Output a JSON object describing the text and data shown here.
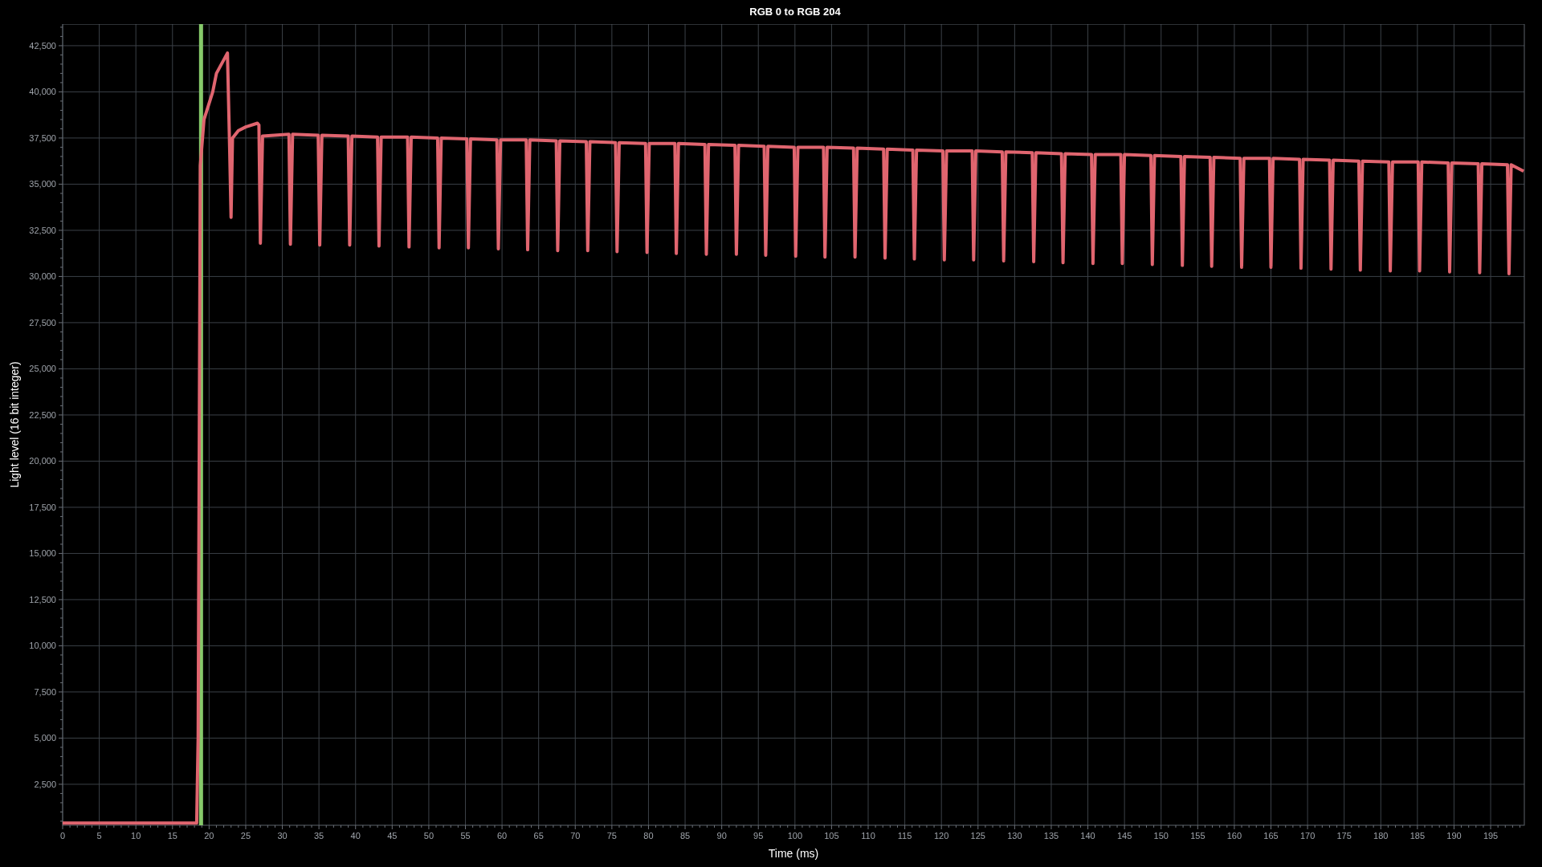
{
  "chart_data": {
    "type": "line",
    "title": "RGB 0 to RGB 204",
    "xlabel": "Time (ms)",
    "ylabel": "Light level (16 bit integer)",
    "x": [
      0,
      18.3,
      18.5,
      18.8,
      19.3,
      20.5,
      21,
      22.5,
      22.8,
      23.0,
      23.2,
      24,
      25,
      26.6,
      26.8,
      27.0,
      27.3,
      30.9,
      31.1,
      31.4,
      34.9,
      35.1,
      35.4,
      39.0,
      39.2,
      39.5,
      43.0,
      43.2,
      43.5,
      47.1,
      47.3,
      47.6,
      51.2,
      51.4,
      51.7,
      55.2,
      55.4,
      55.7,
      59.3,
      59.5,
      59.8,
      63.3,
      63.5,
      63.8,
      67.4,
      67.6,
      67.9,
      71.5,
      71.7,
      72.0,
      75.5,
      75.7,
      76.0,
      79.6,
      79.8,
      80.1,
      83.6,
      83.8,
      84.1,
      87.7,
      87.9,
      88.2,
      91.8,
      92.0,
      92.3,
      95.8,
      96.0,
      96.3,
      99.9,
      100.1,
      100.4,
      103.9,
      104.1,
      104.4,
      108.0,
      108.2,
      108.5,
      112.1,
      112.3,
      112.6,
      116.1,
      116.3,
      116.6,
      120.2,
      120.4,
      120.7,
      124.2,
      124.4,
      124.7,
      128.3,
      128.5,
      128.8,
      132.4,
      132.6,
      132.9,
      136.4,
      136.6,
      136.9,
      140.5,
      140.7,
      141.0,
      144.5,
      144.7,
      145.0,
      148.6,
      148.8,
      149.1,
      152.7,
      152.9,
      153.2,
      156.7,
      156.9,
      157.2,
      160.8,
      161.0,
      161.3,
      164.8,
      165.0,
      165.3,
      168.9,
      169.1,
      169.4,
      173.0,
      173.2,
      173.5,
      177.0,
      177.2,
      177.5,
      181.1,
      181.3,
      181.6,
      185.1,
      185.3,
      185.6,
      189.2,
      189.4,
      189.7,
      193.3,
      193.5,
      193.8,
      197.3,
      197.5,
      197.8,
      199.5
    ],
    "series": [
      {
        "color": "#e0656f",
        "values": [
          400,
          400,
          5000,
          36000,
          38500,
          40000,
          41000,
          42100,
          37000,
          33200,
          37500,
          37900,
          38100,
          38300,
          38200,
          31800,
          37600,
          37700,
          31750,
          37700,
          37650,
          31700,
          37650,
          37600,
          31700,
          37600,
          37550,
          31650,
          37550,
          37550,
          31600,
          37550,
          37500,
          31550,
          37500,
          37450,
          31550,
          37450,
          37400,
          31500,
          37400,
          37400,
          31450,
          37400,
          37350,
          31400,
          37350,
          37300,
          31400,
          37300,
          37250,
          31350,
          37250,
          37200,
          31300,
          37200,
          37200,
          31250,
          37200,
          37150,
          31200,
          37150,
          37100,
          31200,
          37100,
          37050,
          31150,
          37050,
          37000,
          31100,
          37000,
          37000,
          31050,
          37000,
          36950,
          31050,
          36950,
          36900,
          31000,
          36900,
          36850,
          30950,
          36850,
          36800,
          30900,
          36800,
          36800,
          30900,
          36800,
          36750,
          30850,
          36750,
          36700,
          30800,
          36700,
          36650,
          30750,
          36650,
          36600,
          30700,
          36600,
          36600,
          30700,
          36600,
          36550,
          30650,
          36550,
          36500,
          30600,
          36500,
          36450,
          30550,
          36450,
          36400,
          30500,
          36400,
          36400,
          30500,
          36400,
          36350,
          30450,
          36350,
          36300,
          30400,
          36300,
          36250,
          30350,
          36250,
          36200,
          30300,
          36200,
          36200,
          30300,
          36200,
          36150,
          30250,
          36150,
          36100,
          30200,
          36100,
          36050,
          30150,
          36050,
          35700
        ]
      }
    ],
    "xlim": [
      0,
      199.6
    ],
    "ylim": [
      280,
      43670
    ],
    "xticks": [
      0,
      5,
      10,
      15,
      20,
      25,
      30,
      35,
      40,
      45,
      50,
      55,
      60,
      65,
      70,
      75,
      80,
      85,
      90,
      95,
      100,
      105,
      110,
      115,
      120,
      125,
      130,
      135,
      140,
      145,
      150,
      155,
      160,
      165,
      170,
      175,
      180,
      185,
      190,
      195
    ],
    "yticks": [
      {
        "value": 2500,
        "label": "2,500"
      },
      {
        "value": 5000,
        "label": "5,000"
      },
      {
        "value": 7500,
        "label": "7,500"
      },
      {
        "value": 10000,
        "label": "10,000"
      },
      {
        "value": 12500,
        "label": "12,500"
      },
      {
        "value": 15000,
        "label": "15,000"
      },
      {
        "value": 17500,
        "label": "17,500"
      },
      {
        "value": 20000,
        "label": "20,000"
      },
      {
        "value": 22500,
        "label": "22,500"
      },
      {
        "value": 25000,
        "label": "25,000"
      },
      {
        "value": 27500,
        "label": "27,500"
      },
      {
        "value": 30000,
        "label": "30,000"
      },
      {
        "value": 32500,
        "label": "32,500"
      },
      {
        "value": 35000,
        "label": "35,000"
      },
      {
        "value": 37500,
        "label": "37,500"
      },
      {
        "value": 40000,
        "label": "40,000"
      },
      {
        "value": 42500,
        "label": "42,500"
      }
    ],
    "grid": true,
    "ref_lines": [
      {
        "axis": "x",
        "value": 18.9,
        "color": "#86c96a"
      }
    ]
  }
}
